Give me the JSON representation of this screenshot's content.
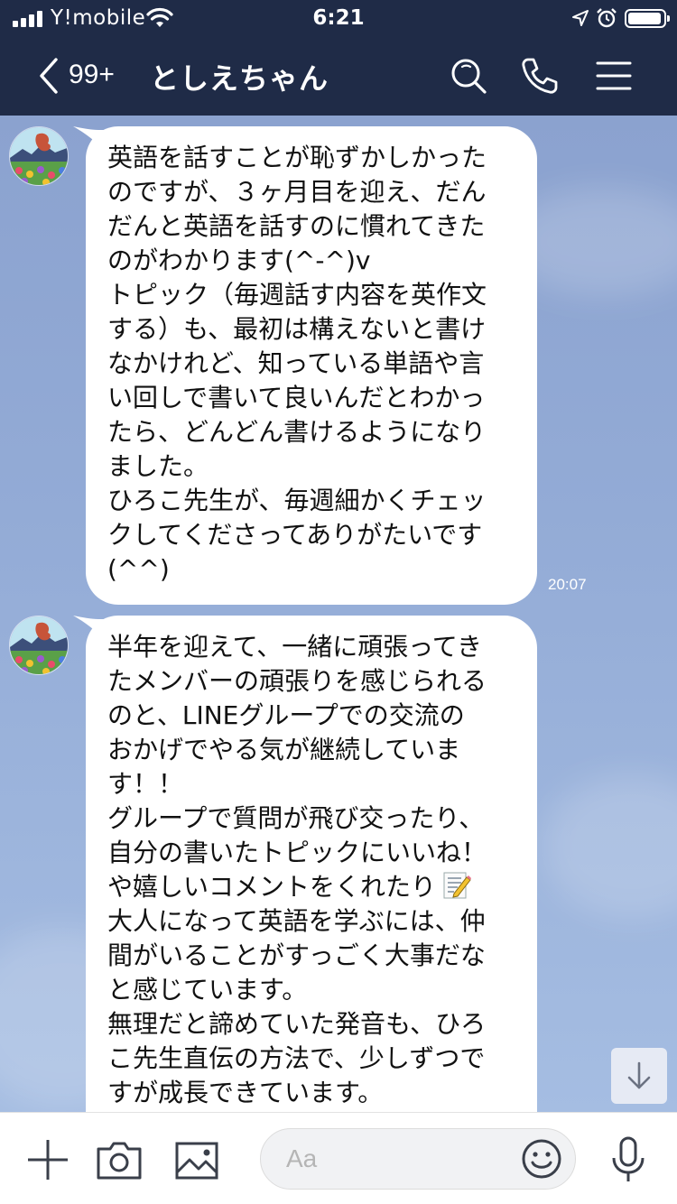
{
  "status_bar": {
    "carrier": "Y!mobile",
    "time": "6:21"
  },
  "header": {
    "unread_count": "99+",
    "chat_title": "としえちゃん"
  },
  "messages": [
    {
      "lines": [
        "英語を話すことが恥ずかしかった",
        "のですが、３ヶ月目を迎え、だん",
        "だんと英語を話すのに慣れてきた",
        "のがわかります(^-^)v",
        "トピック（毎週話す内容を英作文",
        "する）も、最初は構えないと書け",
        "なかけれど、知っている単語や言",
        "い回しで書いて良いんだとわかっ",
        "たら、どんどん書けるようになり",
        "ました。",
        "ひろこ先生が、毎週細かくチェッ",
        "クしてくださってありがたいです",
        "(^^)"
      ],
      "time": "20:07"
    },
    {
      "lines": [
        "半年を迎えて、一緒に頑張ってき",
        "たメンバーの頑張りを感じられる",
        "のと、LINEグループでの交流の",
        "おかげでやる気が継続していま",
        "す！！",
        "グループで質問が飛び交ったり、",
        "自分の書いたトピックにいいね！",
        "や嬉しいコメントをくれたり",
        "大人になって英語を学ぶには、仲",
        "間がいることがすっごく大事だな",
        "と感じています。",
        "無理だと諦めていた発音も、ひろ",
        "こ先生直伝の方法で、少しずつで",
        "すが成長できています。"
      ]
    }
  ],
  "input_bar": {
    "placeholder": "Aa"
  },
  "colors": {
    "header_bg": "#1f2b47",
    "chat_bg": "#93abd6",
    "bubble_bg": "#ffffff"
  },
  "icons": [
    "signal-icon",
    "wifi-icon",
    "location-icon",
    "alarm-icon",
    "battery-icon",
    "back-chevron-icon",
    "search-icon",
    "phone-icon",
    "menu-icon",
    "plus-icon",
    "camera-icon",
    "image-icon",
    "smile-icon",
    "mic-icon",
    "arrow-down-icon",
    "pencil-memo-emoji"
  ]
}
